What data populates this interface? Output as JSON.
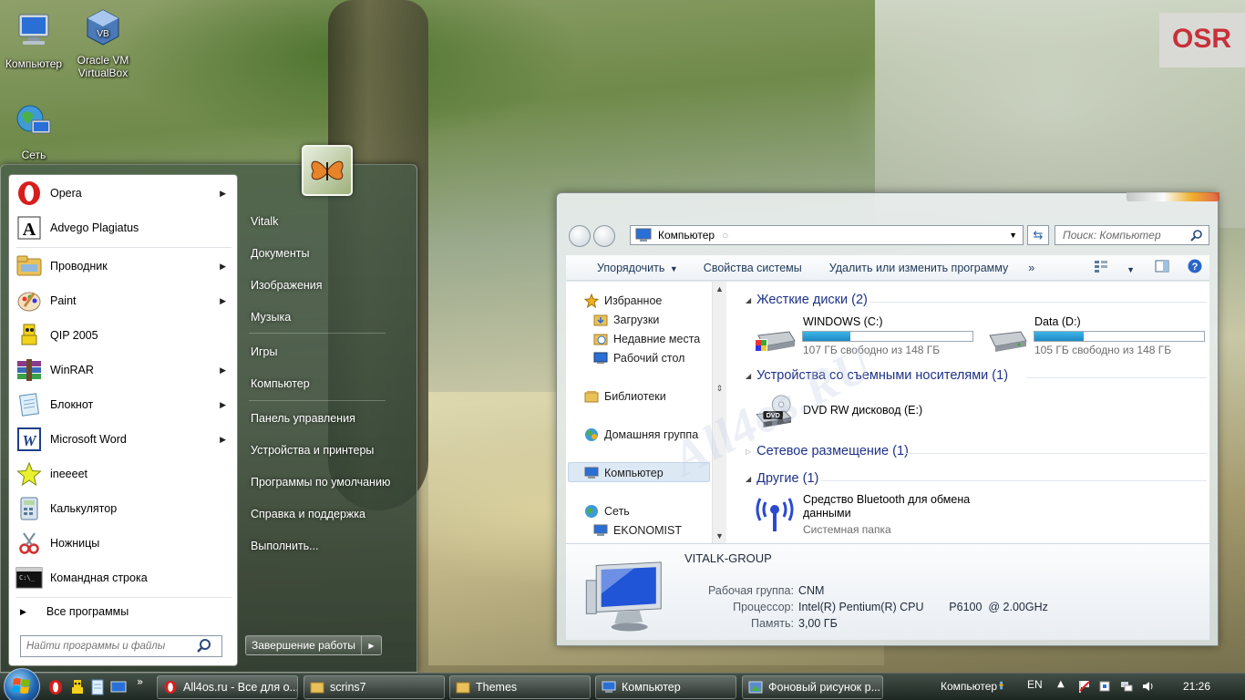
{
  "desktop": {
    "icons": [
      {
        "label": "Компьютер",
        "icon": "computer-icon"
      },
      {
        "label": "Oracle VM VirtualBox",
        "icon": "virtualbox-icon"
      },
      {
        "label": "Сеть",
        "icon": "network-globe-icon"
      }
    ],
    "wallpaper_sign": "OSR",
    "watermark": "All4os.RU"
  },
  "start_menu": {
    "programs": [
      {
        "label": "Opera",
        "icon": "opera-icon",
        "submenu": true
      },
      {
        "label": "Advego Plagiatus",
        "icon": "advego-icon",
        "submenu": false
      },
      {
        "label": "Проводник",
        "icon": "explorer-folder-icon",
        "submenu": true
      },
      {
        "label": "Paint",
        "icon": "paint-icon",
        "submenu": true
      },
      {
        "label": "QIP 2005",
        "icon": "qip-icon",
        "submenu": false
      },
      {
        "label": "WinRAR",
        "icon": "winrar-icon",
        "submenu": true
      },
      {
        "label": "Блокнот",
        "icon": "notepad-icon",
        "submenu": true
      },
      {
        "label": "Microsoft Word",
        "icon": "word-icon",
        "submenu": true
      },
      {
        "label": "ineeeet",
        "icon": "star-icon",
        "submenu": false
      },
      {
        "label": "Калькулятор",
        "icon": "calculator-icon",
        "submenu": false
      },
      {
        "label": "Ножницы",
        "icon": "scissors-icon",
        "submenu": false
      },
      {
        "label": "Командная строка",
        "icon": "cmd-icon",
        "submenu": false
      }
    ],
    "all_programs": "Все программы",
    "search_placeholder": "Найти программы и файлы",
    "right_links": [
      "Vitalk",
      "Документы",
      "Изображения",
      "Музыка",
      "Игры",
      "Компьютер",
      "Панель управления",
      "Устройства и принтеры",
      "Программы по умолчанию",
      "Справка и поддержка",
      "Выполнить..."
    ],
    "shutdown_label": "Завершение работы"
  },
  "explorer": {
    "address": "Компьютер",
    "search_placeholder": "Поиск: Компьютер",
    "toolbar": {
      "organize": "Упорядочить",
      "system_props": "Свойства системы",
      "uninstall": "Удалить или изменить программу",
      "more": "»"
    },
    "nav": {
      "favorites": "Избранное",
      "downloads": "Загрузки",
      "recent": "Недавние места",
      "desktop": "Рабочий стол",
      "libraries": "Библиотеки",
      "homegroup": "Домашняя группа",
      "computer": "Компьютер",
      "network": "Сеть",
      "net_pc": "EKONOMIST"
    },
    "groups": {
      "hdd": "Жесткие диски (2)",
      "removable": "Устройства со съемными носителями (1)",
      "network_loc": "Сетевое размещение (1)",
      "other": "Другие (1)"
    },
    "drives": [
      {
        "name": "WINDOWS (C:)",
        "free": "107 ГБ свободно из 148 ГБ",
        "used_fraction": 0.28
      },
      {
        "name": "Data (D:)",
        "free": "105 ГБ свободно из 148 ГБ",
        "used_fraction": 0.29
      }
    ],
    "dvd": {
      "name": "DVD RW дисковод (E:)",
      "badge": "DVD"
    },
    "bluetooth": {
      "name": "Средство Bluetooth для обмена данными",
      "type": "Системная папка"
    },
    "details": {
      "name": "VITALK-GROUP",
      "workgroup_label": "Рабочая группа:",
      "workgroup": "CNM",
      "cpu_label": "Процессор:",
      "cpu": "Intel(R) Pentium(R) CPU        P6100  @ 2.00GHz",
      "ram_label": "Память:",
      "ram": "3,00 ГБ"
    }
  },
  "taskbar": {
    "buttons": [
      {
        "label": "All4os.ru - Все для о...",
        "icon": "opera-icon"
      },
      {
        "label": "scrins7",
        "icon": "folder-icon"
      },
      {
        "label": "Themes",
        "icon": "folder-icon"
      },
      {
        "label": "Компьютер",
        "icon": "computer-icon"
      },
      {
        "label": "Фоновый рисунок р...",
        "icon": "control-panel-icon"
      }
    ],
    "toolbar_label": "Компьютер",
    "lang": "EN",
    "time": "21:26"
  }
}
